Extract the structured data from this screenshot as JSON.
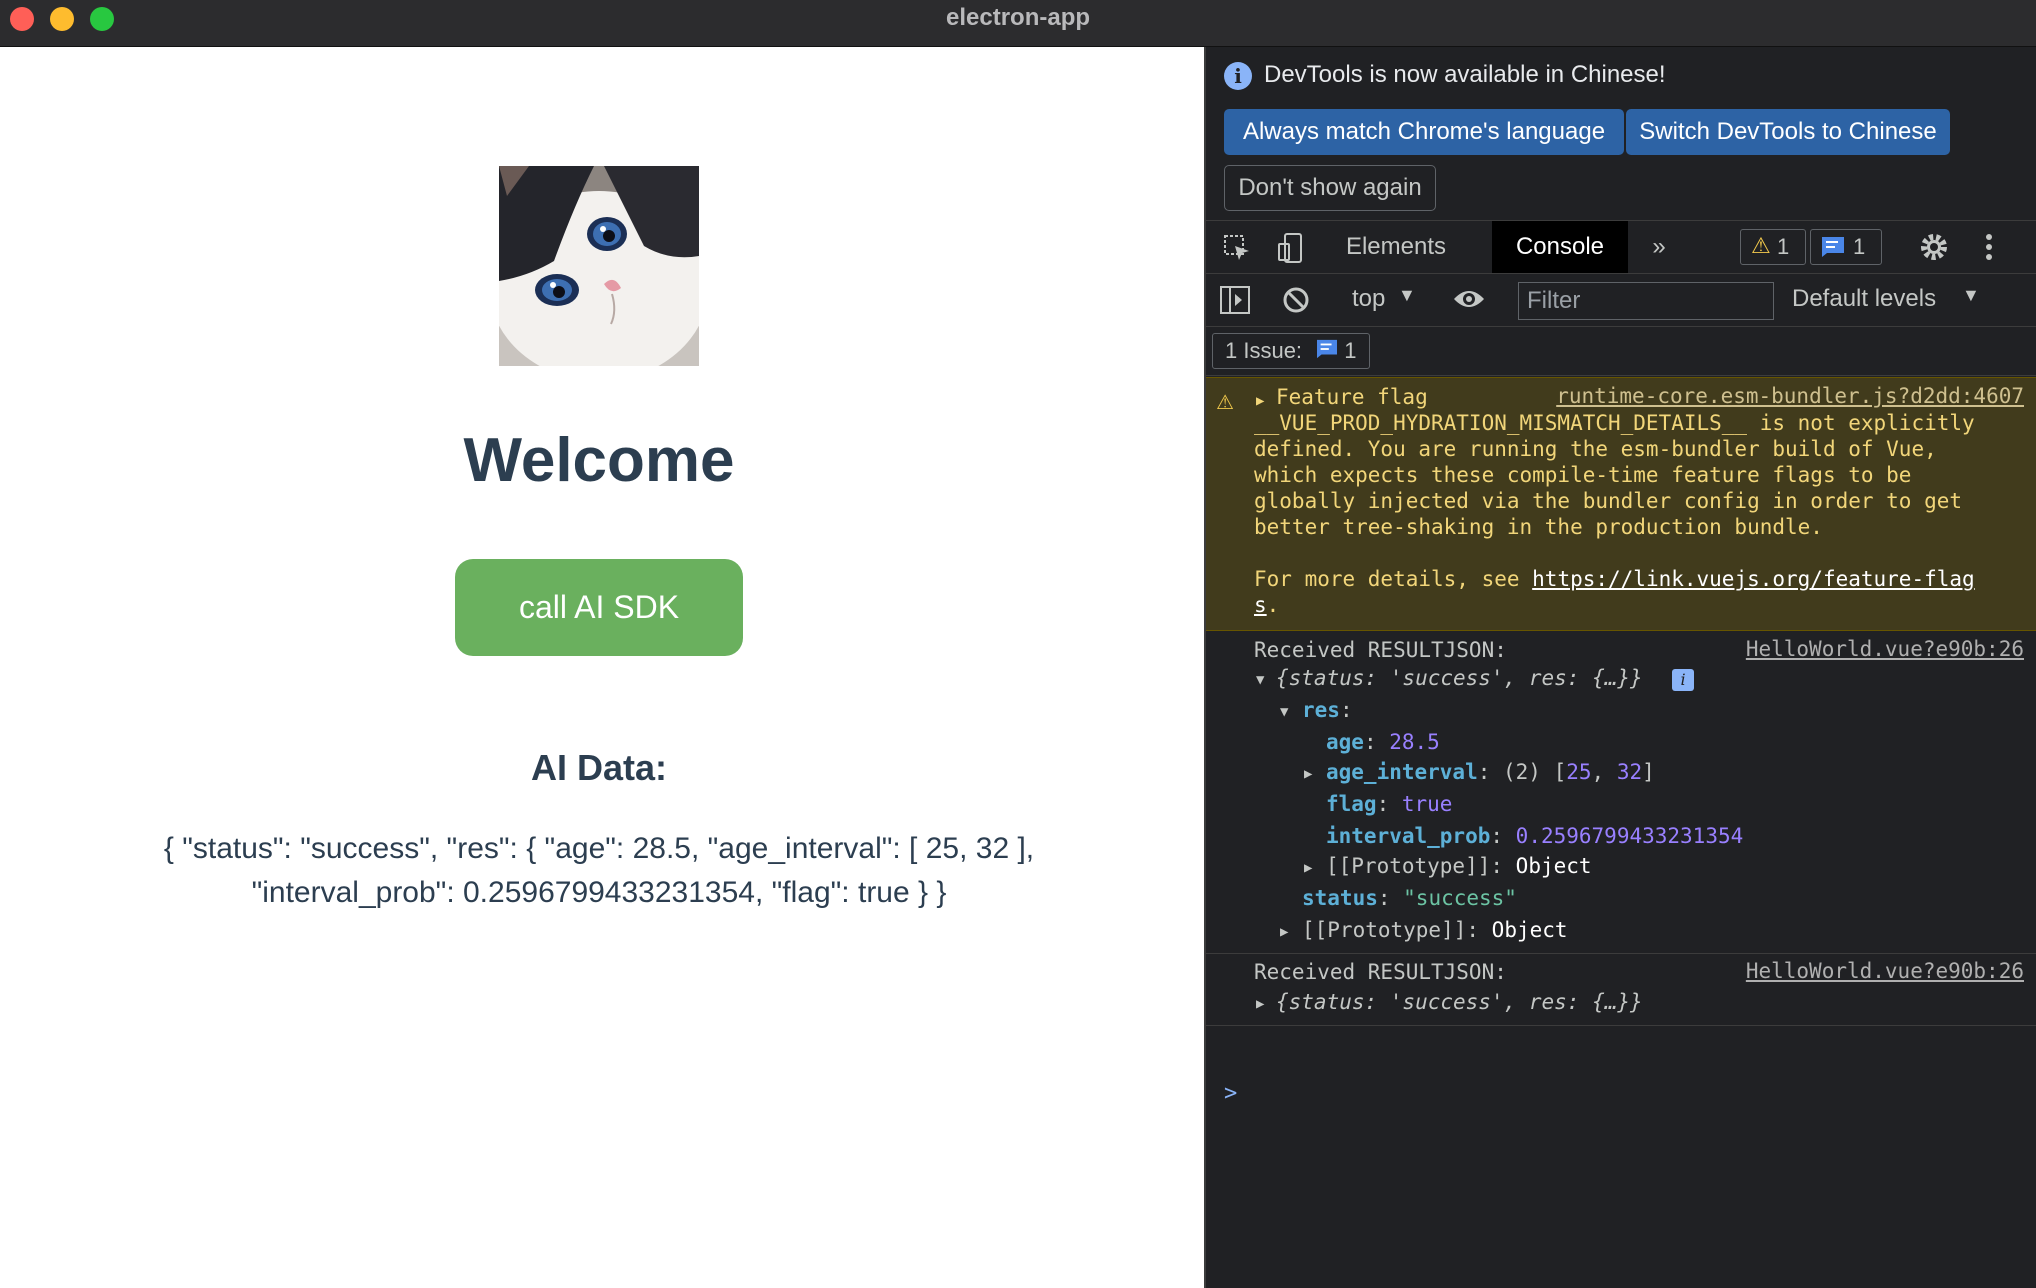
{
  "window": {
    "title": "electron-app"
  },
  "app": {
    "heading": "Welcome",
    "button_label": "call AI SDK",
    "data_heading": "AI Data:",
    "data_line1": "{ \"status\": \"success\", \"res\": { \"age\": 28.5, \"age_interval\": [ 25, 32 ],",
    "data_line2": "\"interval_prob\": 0.2596799433231354, \"flag\": true } }"
  },
  "devtools": {
    "infobar": {
      "message": "DevTools is now available in Chinese!",
      "btn_match": "Always match Chrome's language",
      "btn_switch": "Switch DevTools to Chinese",
      "btn_dont_show": "Don't show again"
    },
    "tabs": {
      "elements": "Elements",
      "console": "Console",
      "more": "»"
    },
    "counts": {
      "warnings": "1",
      "messages": "1"
    },
    "toolbar": {
      "context": "top",
      "filter_placeholder": "Filter",
      "levels": "Default levels"
    },
    "issues": {
      "label": "1 Issue:",
      "count": "1"
    },
    "warning": {
      "title": "Feature flag",
      "source": "runtime-core.esm-bundler.js?d2dd:4607",
      "lines": [
        "__VUE_PROD_HYDRATION_MISMATCH_DETAILS__ is not explicitly",
        "defined. You are running the esm-bundler build of Vue,",
        "which expects these compile-time feature flags to be",
        "globally injected via the bundler config in order to get",
        "better tree-shaking in the production bundle."
      ],
      "more_prefix": "For more details, see ",
      "link": "https://link.vuejs.org/feature-flag",
      "link_tail": "s",
      "link_end": "."
    },
    "log1": {
      "label": "Received RESULTJSON:",
      "source": "HelloWorld.vue?e90b:26",
      "summary": "{status: 'success', res: {…}}",
      "res_key": "res",
      "age_key": "age",
      "age_val": "28.5",
      "interval_key": "age_interval",
      "interval_count": "(2)",
      "interval_a": "25",
      "interval_b": "32",
      "flag_key": "flag",
      "flag_val": "true",
      "prob_key": "interval_prob",
      "prob_val": "0.2596799433231354",
      "proto_label": "[[Prototype]]",
      "proto_val": "Object",
      "status_key": "status",
      "status_val": "\"success\""
    },
    "log2": {
      "label": "Received RESULTJSON:",
      "source": "HelloWorld.vue?e90b:26",
      "summary": "{status: 'success', res: {…}}"
    },
    "prompt": ">"
  }
}
